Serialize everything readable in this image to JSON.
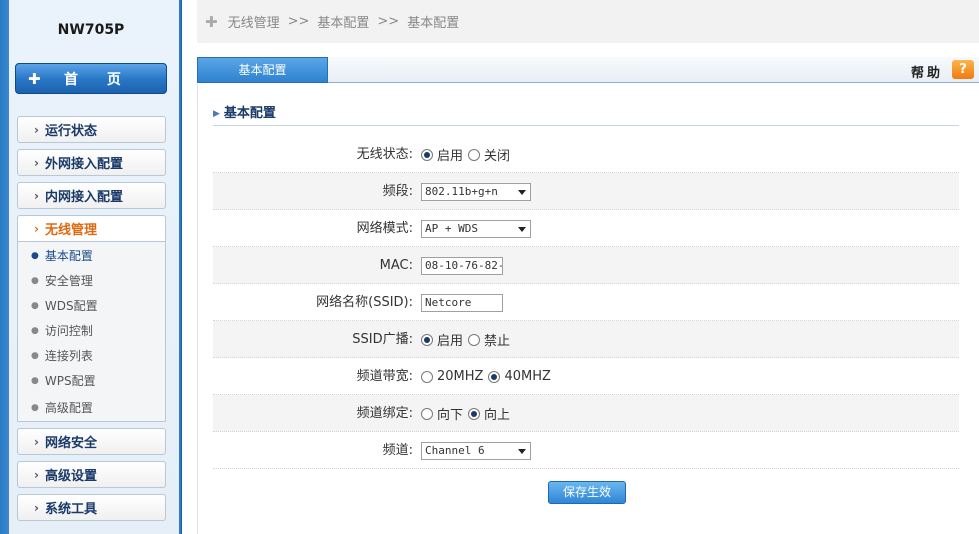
{
  "device": {
    "model": "NW705P"
  },
  "sidebar": {
    "home_label": "首 页",
    "items": [
      {
        "label": "运行状态"
      },
      {
        "label": "外网接入配置"
      },
      {
        "label": "内网接入配置"
      },
      {
        "label": "无线管理"
      },
      {
        "label": "网络安全"
      },
      {
        "label": "高级设置"
      },
      {
        "label": "系统工具"
      }
    ],
    "active_item": "无线管理",
    "submenu": [
      {
        "label": "基本配置"
      },
      {
        "label": "安全管理"
      },
      {
        "label": "WDS配置"
      },
      {
        "label": "访问控制"
      },
      {
        "label": "连接列表"
      },
      {
        "label": "WPS配置"
      },
      {
        "label": "高级配置"
      }
    ],
    "active_submenu": "基本配置"
  },
  "breadcrumb": {
    "items": [
      "无线管理",
      "基本配置",
      "基本配置"
    ],
    "separator": ">>"
  },
  "tabs": {
    "active": "基本配置"
  },
  "help": {
    "label": "帮助",
    "icon": "?"
  },
  "section": {
    "title": "基本配置"
  },
  "form": {
    "wireless_status": {
      "label": "无线状态:",
      "options": [
        "启用",
        "关闭"
      ],
      "selected": "启用"
    },
    "band": {
      "label": "频段:",
      "value": "802.11b+g+n"
    },
    "network_mode": {
      "label": "网络模式:",
      "value": "AP + WDS"
    },
    "mac": {
      "label": "MAC:",
      "value": "08-10-76-82-"
    },
    "ssid": {
      "label": "网络名称(SSID):",
      "value": "Netcore"
    },
    "ssid_broadcast": {
      "label": "SSID广播:",
      "options": [
        "启用",
        "禁止"
      ],
      "selected": "启用"
    },
    "bandwidth": {
      "label": "频道带宽:",
      "options": [
        "20MHZ",
        "40MHZ"
      ],
      "selected": "40MHZ"
    },
    "channel_bind": {
      "label": "频道绑定:",
      "options": [
        "向下",
        "向上"
      ],
      "selected": "向上"
    },
    "channel": {
      "label": "频道:",
      "value": "Channel 6"
    }
  },
  "actions": {
    "save_label": "保存生效"
  },
  "colors": {
    "accent": "#2f82d0",
    "active_menu": "#e06a10",
    "help_icon": "#f07a10"
  }
}
